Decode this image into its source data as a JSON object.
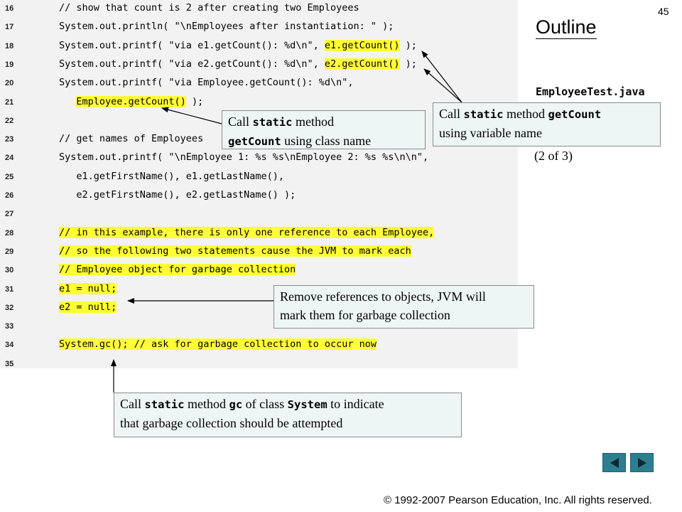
{
  "slide_number": "45",
  "sidebar": {
    "outline_title": "Outline",
    "file_name": "EmployeeTest.java",
    "page_indicator": "(2 of  3)"
  },
  "code_lines": [
    {
      "num": "16",
      "pre": "// show that count is 2 after creating two Employees",
      "hl": "",
      "post": ""
    },
    {
      "num": "17",
      "pre": "System.out.println( \"\\nEmployees after instantiation: \" );",
      "hl": "",
      "post": ""
    },
    {
      "num": "18",
      "pre": "System.out.printf( \"via e1.getCount(): %d\\n\", ",
      "hl": "e1.getCount()",
      "post": " );"
    },
    {
      "num": "19",
      "pre": "System.out.printf( \"via e2.getCount(): %d\\n\", ",
      "hl": "e2.getCount()",
      "post": " );"
    },
    {
      "num": "20",
      "pre": "System.out.printf( \"via Employee.getCount(): %d\\n\",",
      "hl": "",
      "post": ""
    },
    {
      "num": "21",
      "pre": "   ",
      "hl": "Employee.getCount()",
      "post": " );"
    },
    {
      "num": "22",
      "pre": "",
      "hl": "",
      "post": ""
    },
    {
      "num": "23",
      "pre": "// get names of Employees",
      "hl": "",
      "post": ""
    },
    {
      "num": "24",
      "pre": "System.out.printf( \"\\nEmployee 1: %s %s\\nEmployee 2: %s %s\\n\\n\",",
      "hl": "",
      "post": ""
    },
    {
      "num": "25",
      "pre": "   e1.getFirstName(), e1.getLastName(),",
      "hl": "",
      "post": ""
    },
    {
      "num": "26",
      "pre": "   e2.getFirstName(), e2.getLastName() );",
      "hl": "",
      "post": ""
    },
    {
      "num": "27",
      "pre": "",
      "hl": "",
      "post": ""
    },
    {
      "num": "28",
      "pre": "",
      "hl": "// in this example, there is only one reference to each Employee,",
      "post": ""
    },
    {
      "num": "29",
      "pre": "",
      "hl": "// so the following two statements cause the JVM to mark each",
      "post": ""
    },
    {
      "num": "30",
      "pre": "",
      "hl": "// Employee object for garbage collection",
      "post": ""
    },
    {
      "num": "31",
      "pre": "",
      "hl": "e1 = null;",
      "post": ""
    },
    {
      "num": "32",
      "pre": "",
      "hl": "e2 = null;",
      "post": ""
    },
    {
      "num": "33",
      "pre": "",
      "hl": "",
      "post": ""
    },
    {
      "num": "34",
      "pre": "",
      "hl": "System.gc(); // ask for garbage collection to occur now",
      "post": ""
    },
    {
      "num": "35",
      "pre": "",
      "hl": "",
      "post": ""
    }
  ],
  "callouts": {
    "class_name": {
      "t1": "Call ",
      "c1": "static",
      "t2": " method",
      "c2": "getCount",
      "t3": " using class name"
    },
    "variable_name": {
      "t1": "Call ",
      "c1": "static",
      "t2": " method ",
      "c2": "getCount",
      "t3": "using variable name"
    },
    "remove_refs": {
      "line1": "Remove references to objects, JVM will",
      "line2": "mark them for garbage collection"
    },
    "gc_call": {
      "t1": "Call ",
      "c1": "static",
      "t2": " method ",
      "c2": "gc",
      "t3": " of class ",
      "c3": "System",
      "t4": " to indicate",
      "line2": "that garbage collection should be attempted"
    }
  },
  "nav": {
    "prev_icon": "triangle-left-icon",
    "next_icon": "triangle-right-icon",
    "color": "#2d7f90"
  },
  "copyright": "© 1992-2007 Pearson Education, Inc.  All rights reserved."
}
